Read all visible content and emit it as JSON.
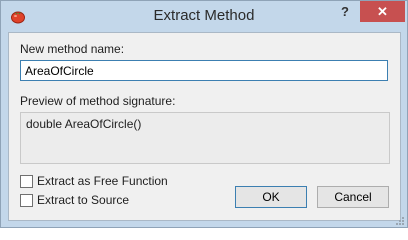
{
  "window": {
    "title": "Extract Method",
    "help_label": "?",
    "close_label": "✕"
  },
  "form": {
    "method_name_label": "New method name:",
    "method_name_value": "AreaOfCircle",
    "preview_label": "Preview of method signature:",
    "preview_value": "double AreaOfCircle()"
  },
  "options": {
    "free_function_label": "Extract as Free Function",
    "free_function_checked": false,
    "to_source_label": "Extract to Source",
    "to_source_checked": false
  },
  "buttons": {
    "ok_label": "OK",
    "cancel_label": "Cancel"
  },
  "colors": {
    "title_bar": "#c3d7ea",
    "close_button": "#c75050",
    "app_icon": "#e0422a"
  },
  "icons": {
    "app": "tomato-icon",
    "resize": "resize-grip-icon"
  }
}
